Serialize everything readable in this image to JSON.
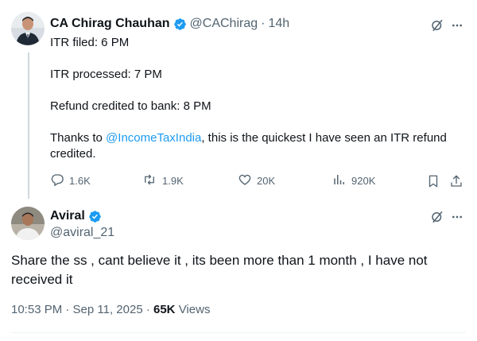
{
  "parent_tweet": {
    "author_name": "CA Chirag Chauhan",
    "handle": "@CAChirag",
    "separator": "·",
    "time": "14h",
    "lines": [
      "ITR filed: 6 PM",
      "ITR processed: 7 PM",
      "Refund credited to bank: 8 PM"
    ],
    "thanks_prefix": "Thanks to ",
    "mention": "@IncomeTaxIndia",
    "thanks_suffix": ", this is the quickest I have seen an ITR refund credited.",
    "stats": {
      "replies": "1.6K",
      "reposts": "1.9K",
      "likes": "20K",
      "views": "920K"
    }
  },
  "reply_tweet": {
    "author_name": "Aviral",
    "handle": "@aviral_21",
    "text": "Share the ss , cant believe it , its been more than 1 month , I have not received it",
    "timestamp": "10:53 PM · Sep 11, 2025 · ",
    "views_count": "65K",
    "views_label": " Views"
  },
  "icons": {
    "verified": "verified-badge-icon",
    "grok": "grok-icon",
    "more": "more-icon",
    "reply": "reply-icon",
    "repost": "repost-icon",
    "like": "like-icon",
    "views": "views-icon",
    "bookmark": "bookmark-icon",
    "share": "share-icon"
  },
  "colors": {
    "accent": "#1d9bf0",
    "secondary_text": "#536471",
    "primary_text": "#0f1419"
  }
}
